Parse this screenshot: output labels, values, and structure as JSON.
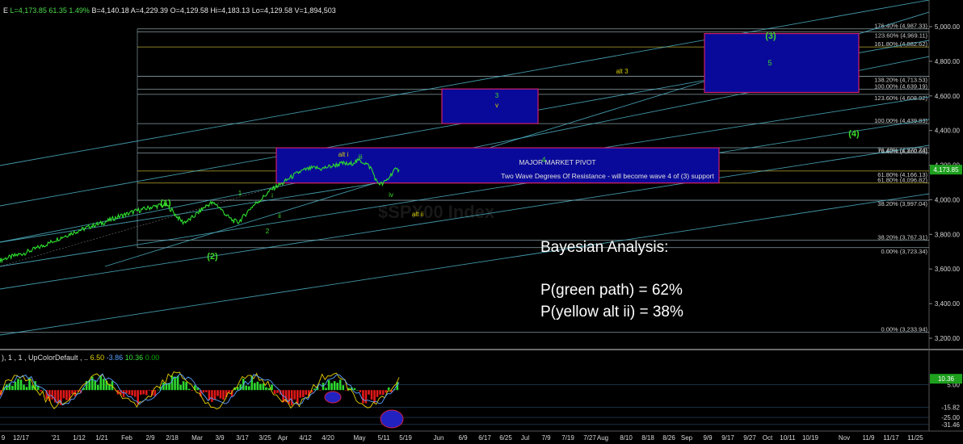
{
  "header": {
    "prefix": "E",
    "last": "L=4,173.85",
    "change": "61.35",
    "pct": "1.49%",
    "bid": "B=4,140.18",
    "ask": "A=4,229.39",
    "open": "O=4,129.58",
    "high": "Hi=4,183.13",
    "low": "Lo=4,129.58",
    "volume": "V=1,894,503"
  },
  "indicator_header": {
    "name": "), 1 , 1 , UpColorDefault , ..",
    "v1": "6.50",
    "v2": "-3.86",
    "v3": "10.36",
    "v4": "0.00"
  },
  "annotations": {
    "pivot_title": "MAJOR MARKET PIVOT",
    "pivot_sub": "Two Wave Degrees Of Resistance - will become wave 4 of (3) support",
    "wave_3_paren": "(3)",
    "wave_5": "5",
    "wave_3v_a": "3",
    "wave_3v_b": "v",
    "wave_4": "4",
    "wave_4_paren": "(4)",
    "alt_3": "alt 3",
    "alt_i": "alt i",
    "alt_ii": "alt ii",
    "wave_iii": "iii",
    "wave_iv": "iv",
    "wave_1_paren": "(1)",
    "wave_2_paren": "(2)",
    "wave_1": "1",
    "wave_2": "2",
    "wave_i": "i",
    "wave_ii": "ii",
    "watermark": "$SPX00 Index"
  },
  "bayesian": {
    "title": "Bayesian Analysis:",
    "green": "P(green path) = 62%",
    "yellow": "P(yellow alt ii) = 38%"
  },
  "colors": {
    "price": "#2ee02e",
    "channel": "#4fb3c8",
    "box_fill": "#0a0a9a",
    "box_border": "#d0206a",
    "fib_line": "#9fb8c0",
    "fib_gold": "#b8a830",
    "green_label": "#3cdc28",
    "yellow_label": "#d8d000"
  },
  "chart_data": {
    "type": "line",
    "title": "",
    "series_name": "",
    "y_axis_ticks": [
      "5,000.00",
      "4,800.00",
      "4,600.00",
      "4,400.00",
      "4,200.00",
      "4,000.00",
      "3,800.00",
      "3,600.00",
      "3,400.00",
      "3,200.00"
    ],
    "y_axis_values": [
      5000,
      4800,
      4600,
      4400,
      4200,
      4000,
      3800,
      3600,
      3400,
      3200
    ],
    "ylim": [
      3100,
      5150
    ],
    "last_price_label": "4,173.85",
    "last_price": 4173.85,
    "x_labels": [
      "9",
      "12/17",
      "'21",
      "1/12",
      "1/21",
      "Feb",
      "2/9",
      "2/18",
      "Mar",
      "3/9",
      "3/17",
      "3/25",
      "Apr",
      "4/12",
      "4/20",
      "May",
      "5/11",
      "5/19",
      "Jun",
      "6/9",
      "6/17",
      "6/25",
      "Jul",
      "7/9",
      "7/19",
      "7/27",
      "Aug",
      "8/10",
      "8/18",
      "8/26",
      "Sep",
      "9/9",
      "9/17",
      "9/27",
      "Oct",
      "10/11",
      "10/19",
      "Nov",
      "11/9",
      "11/17",
      "11/25"
    ],
    "fib_levels": [
      {
        "label": "176.40% (4,987.33)",
        "value": 4987.33
      },
      {
        "label": "123.60% (4,969.11)",
        "value": 4969.11
      },
      {
        "label": "161.80% (4,882.62)",
        "value": 4882.62
      },
      {
        "label": "138.20% (4,713.53)",
        "value": 4713.53
      },
      {
        "label": "100.00% (4,639.19)",
        "value": 4639.19
      },
      {
        "label": "123.60% (4,608.92)",
        "value": 4608.92
      },
      {
        "label": "100.00% (4,439.83)",
        "value": 4439.83
      },
      {
        "label": "76.40% (4,300.68)",
        "value": 4300.68
      },
      {
        "label": "76.40% (4,270.74)",
        "value": 4270.74
      },
      {
        "label": "61.80% (4,166.13)",
        "value": 4166.13
      },
      {
        "label": "61.80% (4,096.82)",
        "value": 4096.82
      },
      {
        "label": "38.20% (3,997.04)",
        "value": 3997.04
      },
      {
        "label": "38.20% (3,767.31)",
        "value": 3767.31
      },
      {
        "label": "0.00% (3,723.34)",
        "value": 3723.34
      },
      {
        "label": "0.00% (3,233.94)",
        "value": 3233.94
      }
    ],
    "price_series": [
      3650,
      3662,
      3670,
      3680,
      3688,
      3700,
      3712,
      3725,
      3738,
      3752,
      3768,
      3782,
      3795,
      3808,
      3820,
      3830,
      3842,
      3855,
      3860,
      3872,
      3885,
      3898,
      3910,
      3918,
      3930,
      3938,
      3946,
      3955,
      3962,
      3968,
      3970,
      3940,
      3900,
      3870,
      3880,
      3905,
      3932,
      3960,
      3980,
      3975,
      3940,
      3905,
      3880,
      3870,
      3905,
      3945,
      3975,
      4000,
      4030,
      4060,
      4080,
      4095,
      4120,
      4140,
      4160,
      4172,
      4180,
      4185,
      4178,
      4188,
      4195,
      4205,
      4210,
      4202,
      4220,
      4226,
      4210,
      4180,
      4100,
      4090,
      4120,
      4168,
      4175
    ],
    "price_range_dates": [
      "12/17",
      "5/13"
    ],
    "indicator": {
      "ticks": [
        "5.00",
        "-15.82",
        "-25.00",
        "-31.46"
      ],
      "tick_values": [
        5,
        -15.82,
        -25,
        -31.46
      ],
      "last_label": "10.36",
      "last_value": 10.36,
      "ylim": [
        -36,
        26
      ]
    }
  }
}
